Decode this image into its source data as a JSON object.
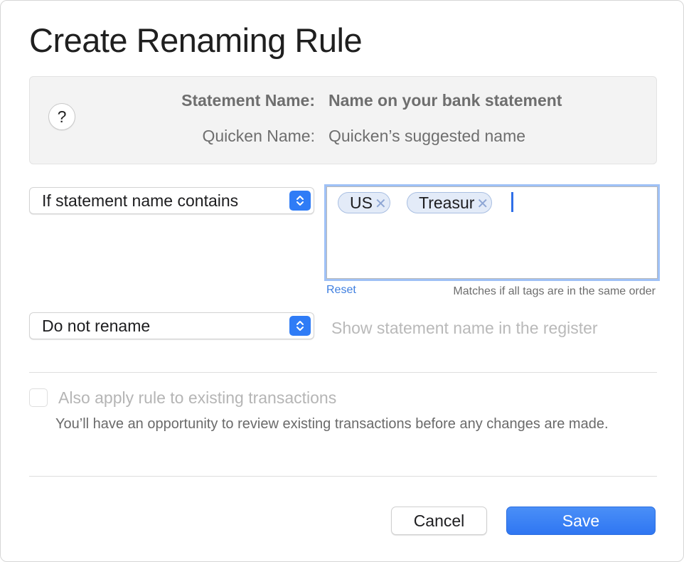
{
  "dialog": {
    "title": "Create Renaming Rule"
  },
  "info": {
    "help_label": "?",
    "statement_label": "Statement Name:",
    "statement_value": "Name on your bank statement",
    "quicken_label": "Quicken Name:",
    "quicken_value": "Quicken’s suggested name"
  },
  "condition": {
    "selected": "If statement name contains",
    "tags": [
      "US",
      "Treasur"
    ],
    "tag_remove_glyph": "✕",
    "reset_label": "Reset",
    "hint": "Matches if all tags are in the same order"
  },
  "rename": {
    "selected": "Do not rename",
    "hint": "Show statement name in the register"
  },
  "existing": {
    "label": "Also apply rule to existing transactions",
    "checked": false,
    "description": "You’ll have an opportunity to review existing transactions before any changes are made."
  },
  "buttons": {
    "cancel": "Cancel",
    "save": "Save"
  },
  "colors": {
    "accent": "#2f7cf6",
    "tag_bg": "#e3ebf8",
    "focus_ring": "#9fc1f6"
  }
}
